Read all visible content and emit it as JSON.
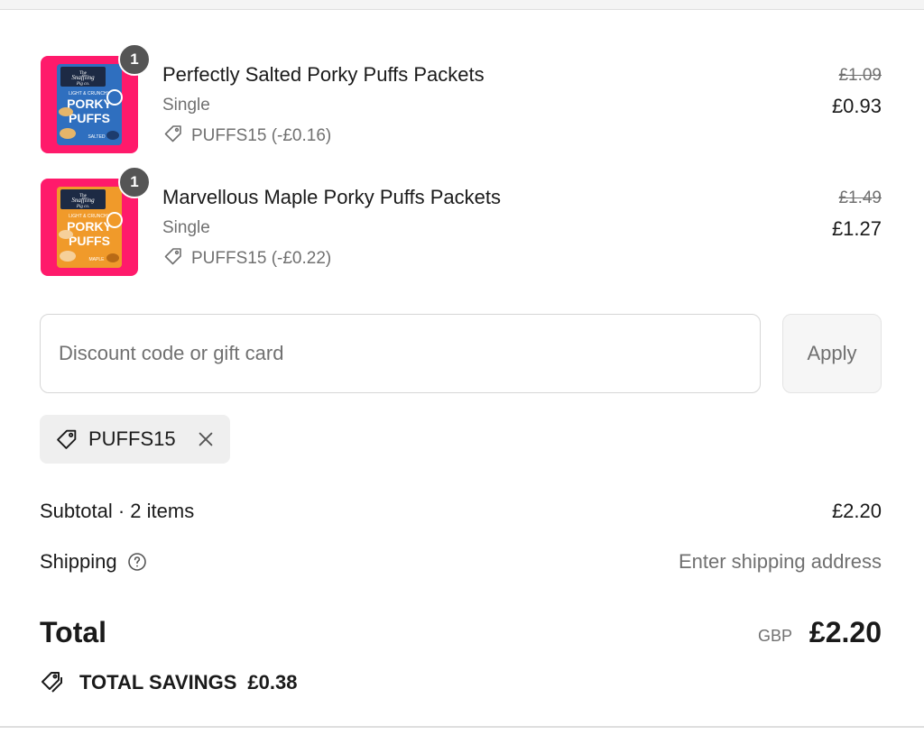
{
  "colors": {
    "thumb_bg": "#ff1a6b",
    "pack_salted": "#2f6fbf",
    "pack_maple": "#f09a2a",
    "muted_text": "#707070",
    "badge": "#555555"
  },
  "items": [
    {
      "quantity": "1",
      "title": "Perfectly Salted Porky Puffs Packets",
      "variant": "Single",
      "discount": "PUFFS15 (-£0.16)",
      "price_original": "£1.09",
      "price_final": "£0.93",
      "pack": {
        "brand_line1": "The",
        "brand_line2": "Snaffling",
        "brand_line3": "Pig co.",
        "tagline": "LIGHT & CRUNCHY",
        "name_line1": "PORKY",
        "name_line2": "PUFFS",
        "flavour": "SALTED",
        "color": "#2f6fbf",
        "burst": "WIDE & PUFFED"
      }
    },
    {
      "quantity": "1",
      "title": "Marvellous Maple Porky Puffs Packets",
      "variant": "Single",
      "discount": "PUFFS15 (-£0.22)",
      "price_original": "£1.49",
      "price_final": "£1.27",
      "pack": {
        "brand_line1": "The",
        "brand_line2": "Snaffling",
        "brand_line3": "Pig co.",
        "tagline": "LIGHT & CRUNCHY",
        "name_line1": "PORKY",
        "name_line2": "PUFFS",
        "flavour": "MAPLE",
        "color": "#f09a2a",
        "burst": "WIDE & PUFFED"
      }
    }
  ],
  "discount_form": {
    "placeholder": "Discount code or gift card",
    "value": "",
    "apply_label": "Apply"
  },
  "applied_code": {
    "label": "PUFFS15"
  },
  "summary": {
    "subtotal_label": "Subtotal · 2 items",
    "subtotal_value": "£2.20",
    "shipping_label": "Shipping",
    "shipping_value": "Enter shipping address",
    "total_label": "Total",
    "total_currency": "GBP",
    "total_value": "£2.20",
    "savings_label": "TOTAL SAVINGS",
    "savings_value": "£0.38"
  },
  "icons": {
    "tag": "tag-icon",
    "close": "close-icon",
    "help": "help-circle-icon",
    "savings": "double-tag-icon"
  }
}
